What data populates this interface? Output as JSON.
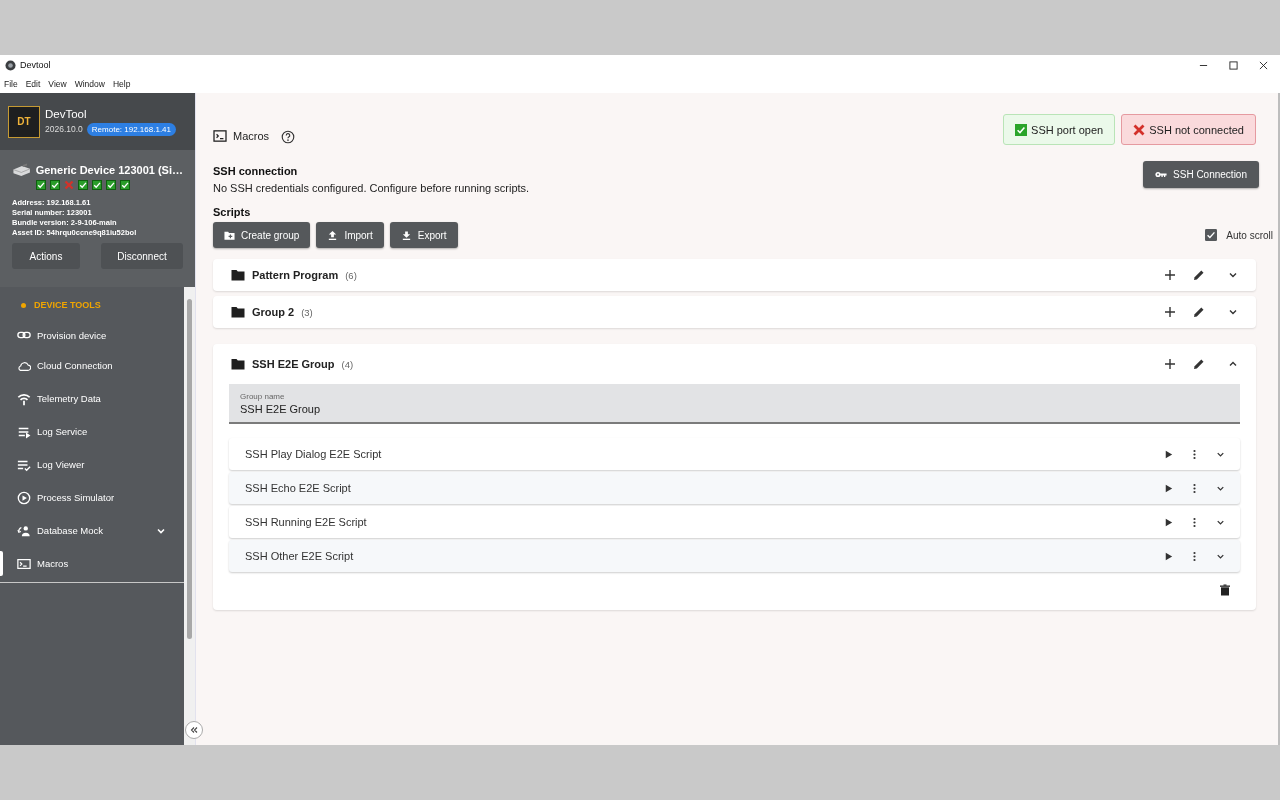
{
  "window": {
    "title": "Devtool"
  },
  "menu": [
    "File",
    "Edit",
    "View",
    "Window",
    "Help"
  ],
  "app": {
    "logo": "DT",
    "name": "DevTool",
    "version": "2026.10.0",
    "remote": "Remote: 192.168.1.41"
  },
  "device": {
    "name": "Generic Device 123001 (Si…",
    "checks": [
      {
        "ok": true
      },
      {
        "ok": true
      },
      {
        "ok": false
      },
      {
        "ok": true
      },
      {
        "ok": true
      },
      {
        "ok": true
      },
      {
        "ok": true
      }
    ],
    "details": [
      "Address: 192.168.1.61",
      "Serial number: 123001",
      "Bundle version: 2-9-106-main",
      "Asset ID: 54hrqu0ccne9q81iu52bol"
    ],
    "buttons": [
      "Actions",
      "Disconnect"
    ]
  },
  "nav": {
    "section": "DEVICE TOOLS",
    "items": [
      {
        "label": "Provision device",
        "selected": false
      },
      {
        "label": "Cloud Connection",
        "selected": false
      },
      {
        "label": "Telemetry Data",
        "selected": false
      },
      {
        "label": "Log Service",
        "selected": false
      },
      {
        "label": "Log Viewer",
        "selected": false
      },
      {
        "label": "Process Simulator",
        "selected": false
      },
      {
        "label": "Database Mock",
        "selected": false,
        "expanded": false
      },
      {
        "label": "Macros",
        "selected": true
      }
    ]
  },
  "page": {
    "title": "Macros",
    "badges": [
      {
        "label": "SSH port open",
        "ok": true
      },
      {
        "label": "SSH not connected",
        "ok": false
      }
    ],
    "ssh": {
      "heading": "SSH connection",
      "message": "No SSH credentials configured. Configure before running scripts.",
      "button": "SSH Connection"
    },
    "scripts": {
      "heading": "Scripts",
      "buttons": [
        "Create group",
        "Import",
        "Export"
      ],
      "auto_scroll": {
        "label": "Auto scroll",
        "checked": true
      },
      "groups": [
        {
          "name": "Pattern Program",
          "count": "(6)",
          "expanded": false
        },
        {
          "name": "Group 2",
          "count": "(3)",
          "expanded": false
        },
        {
          "name": "SSH E2E Group",
          "count": "(4)",
          "expanded": true,
          "field": {
            "label": "Group name",
            "value": "SSH E2E Group"
          },
          "scripts": [
            {
              "name": "SSH Play Dialog E2E Script"
            },
            {
              "name": "SSH Echo E2E Script"
            },
            {
              "name": "SSH Running E2E Script"
            },
            {
              "name": "SSH Other E2E Script"
            }
          ]
        }
      ]
    }
  }
}
